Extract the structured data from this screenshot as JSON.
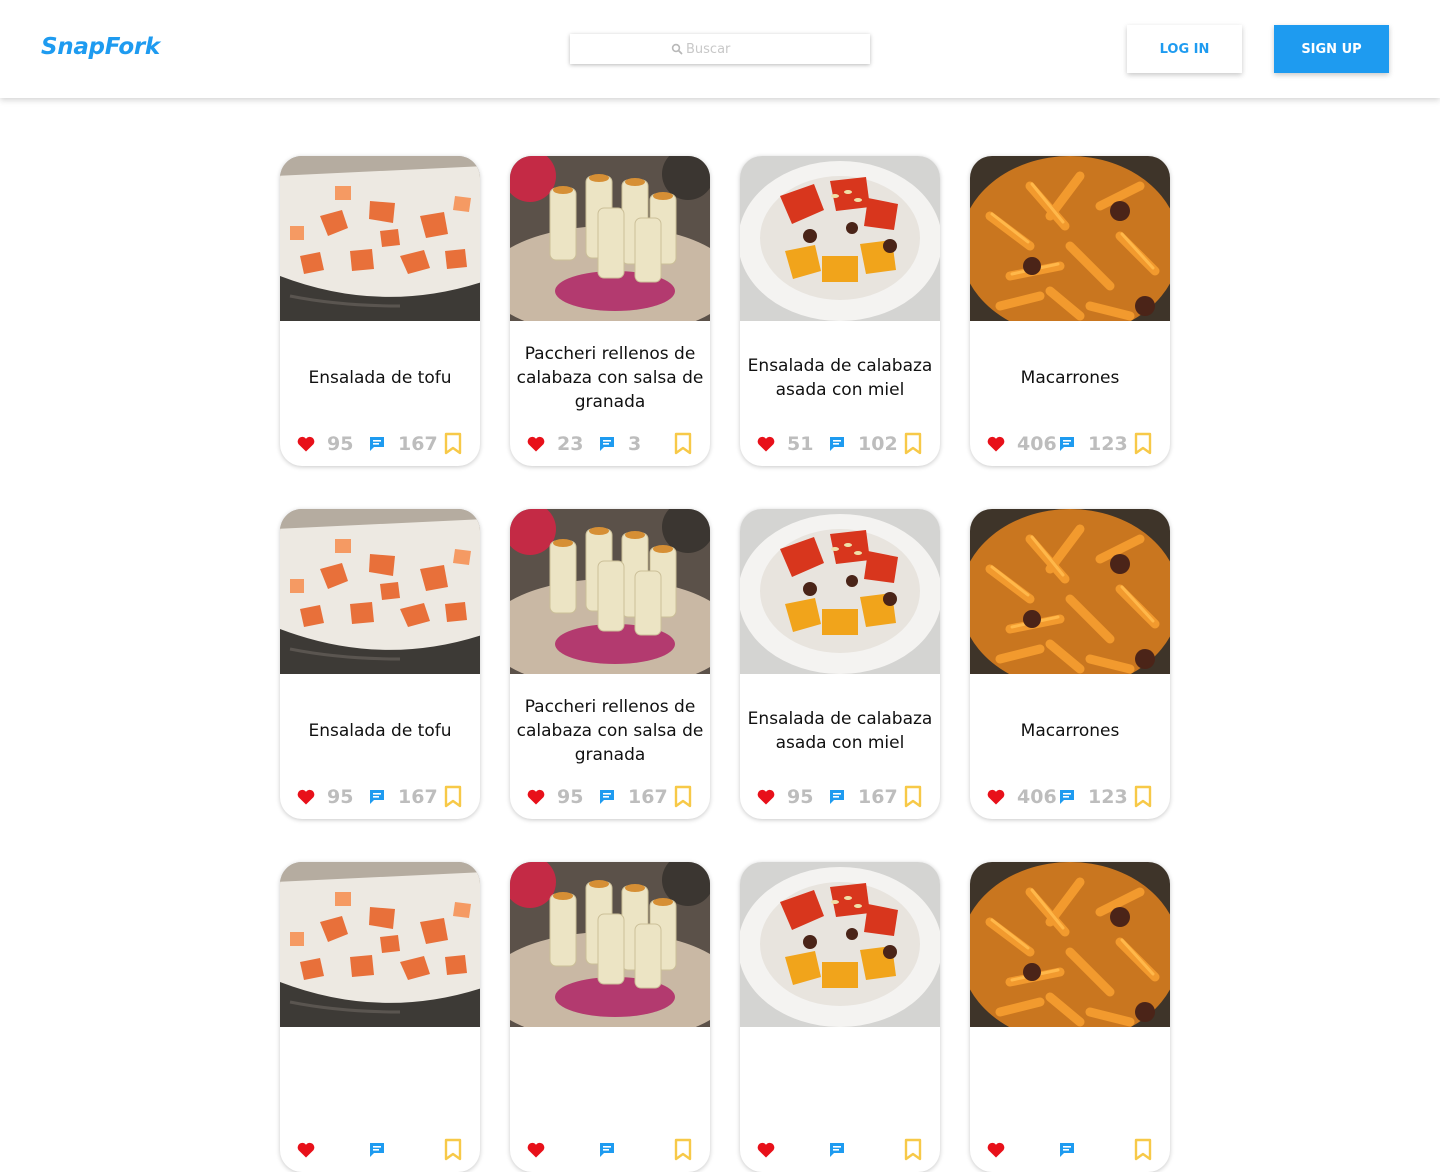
{
  "header": {
    "logo": "SnapFork",
    "search_placeholder": "Buscar",
    "login_label": "LOG IN",
    "signup_label": "SIGN UP"
  },
  "colors": {
    "brand": "#1e9bf0",
    "heart": "#e8101a",
    "comment": "#1e9bf0",
    "bookmark": "#f7c948",
    "count": "#bdbdbd"
  },
  "recipes": [
    {
      "title": "Ensalada de tofu",
      "likes": "95",
      "comments": "167",
      "image": "tofu-salad"
    },
    {
      "title": "Paccheri rellenos de calabaza con salsa de granada",
      "likes": "23",
      "comments": "3",
      "image": "paccheri"
    },
    {
      "title": "Ensalada de calabaza asada con miel",
      "likes": "51",
      "comments": "102",
      "image": "pumpkin-salad"
    },
    {
      "title": "Macarrones",
      "likes": "406",
      "comments": "123",
      "image": "macaroni"
    },
    {
      "title": "Ensalada de tofu",
      "likes": "95",
      "comments": "167",
      "image": "tofu-salad"
    },
    {
      "title": "Paccheri rellenos de calabaza con salsa de granada",
      "likes": "95",
      "comments": "167",
      "image": "paccheri"
    },
    {
      "title": "Ensalada de calabaza asada con miel",
      "likes": "95",
      "comments": "167",
      "image": "pumpkin-salad"
    },
    {
      "title": "Macarrones",
      "likes": "406",
      "comments": "123",
      "image": "macaroni"
    },
    {
      "title": "",
      "likes": "",
      "comments": "",
      "image": "tofu-salad"
    },
    {
      "title": "",
      "likes": "",
      "comments": "",
      "image": "paccheri"
    },
    {
      "title": "",
      "likes": "",
      "comments": "",
      "image": "pumpkin-salad"
    },
    {
      "title": "",
      "likes": "",
      "comments": "",
      "image": "macaroni"
    }
  ]
}
